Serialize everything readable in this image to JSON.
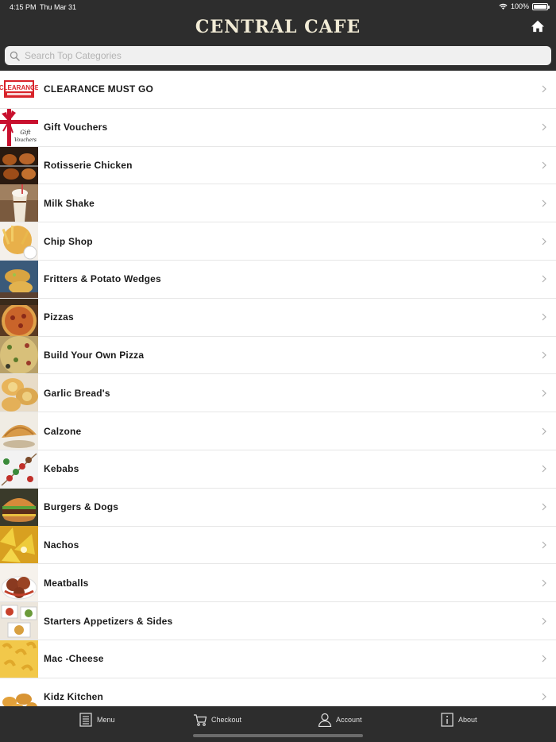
{
  "status_bar": {
    "time": "4:15 PM",
    "date": "Thu Mar 31",
    "battery": "100%"
  },
  "header": {
    "title": "CENTRAL CAFE"
  },
  "search": {
    "placeholder": "Search Top Categories"
  },
  "categories": [
    {
      "label": "CLEARANCE MUST GO",
      "thumb": "clearance-sign"
    },
    {
      "label": "Gift Vouchers",
      "thumb": "gift-voucher"
    },
    {
      "label": "Rotisserie Chicken",
      "thumb": "rotisserie"
    },
    {
      "label": "Milk Shake",
      "thumb": "milkshake"
    },
    {
      "label": "Chip Shop",
      "thumb": "fries"
    },
    {
      "label": "Fritters & Potato Wedges",
      "thumb": "fritters"
    },
    {
      "label": "Pizzas",
      "thumb": "pizza"
    },
    {
      "label": "Build Your Own Pizza",
      "thumb": "pizza-build"
    },
    {
      "label": "Garlic Bread's",
      "thumb": "garlic-bread"
    },
    {
      "label": "Calzone",
      "thumb": "calzone"
    },
    {
      "label": "Kebabs",
      "thumb": "kebab"
    },
    {
      "label": "Burgers & Dogs",
      "thumb": "burger"
    },
    {
      "label": "Nachos",
      "thumb": "nachos"
    },
    {
      "label": "Meatballs",
      "thumb": "meatballs"
    },
    {
      "label": "Starters Appetizers & Sides",
      "thumb": "starters"
    },
    {
      "label": "Mac -Cheese",
      "thumb": "mac-cheese"
    },
    {
      "label": "Kidz Kitchen",
      "thumb": "nuggets"
    }
  ],
  "tabbar": {
    "menu": "Menu",
    "checkout": "Checkout",
    "account": "Account",
    "about": "About"
  },
  "colors": {
    "bar": "#2d2d2d",
    "title": "#f2ecd6",
    "row_text": "#1a1a1a",
    "divider": "#e6e6e6"
  }
}
